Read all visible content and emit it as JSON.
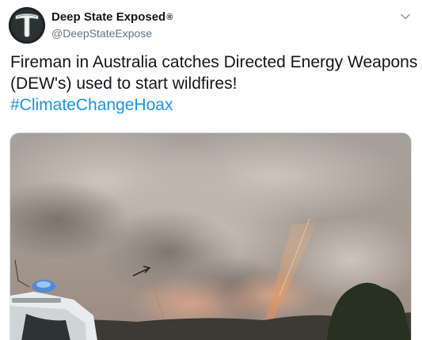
{
  "account": {
    "display_name": "Deep State Exposed",
    "registered_mark": "®",
    "handle": "@DeepStateExpose",
    "avatar_icon": "letter-t-logo"
  },
  "tweet": {
    "text_line1": "Fireman in Australia catches Directed Energy Weapons",
    "text_line2": "(DEW's) used to start wildfires!",
    "hashtag": "#ClimateChangeHoax"
  },
  "media": {
    "description_icon": "wildfire-photo"
  },
  "colors": {
    "hashtag": "#1b95e0",
    "handle": "#657786",
    "text": "#14171a"
  },
  "menu_icon": "chevron-down-icon"
}
